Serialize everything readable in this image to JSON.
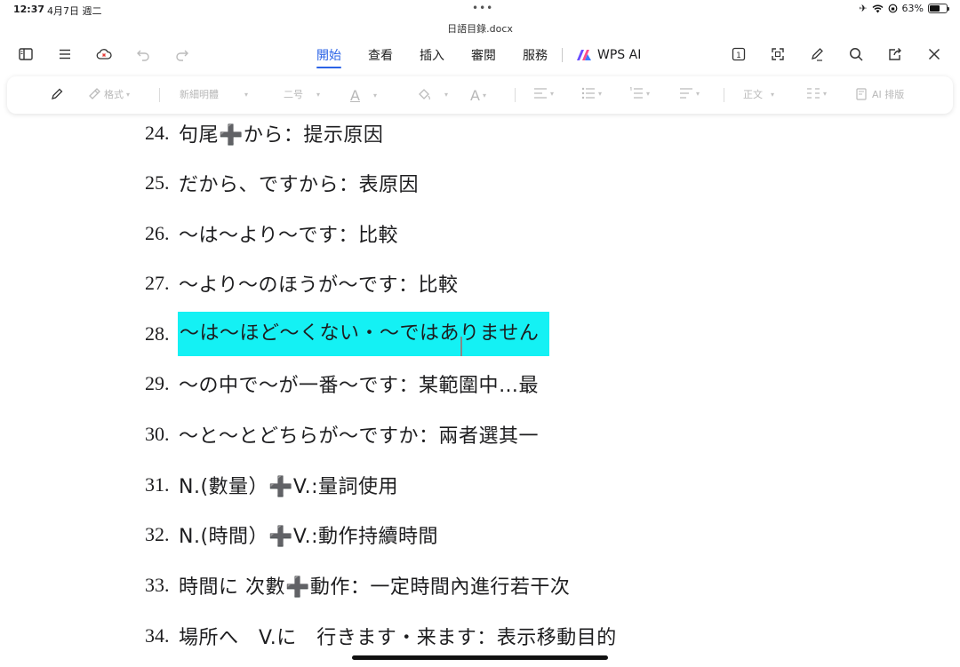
{
  "status_bar": {
    "time": "12:37",
    "date": "4月7日 週二",
    "battery": "63%",
    "battery_level": 0.63
  },
  "document": {
    "filename": "日語目錄.docx"
  },
  "menu": {
    "tabs": [
      "開始",
      "查看",
      "插入",
      "審閱",
      "服務"
    ],
    "active_tab": "開始",
    "ai_label": "WPS AI",
    "page_indicator": "1"
  },
  "format_toolbar": {
    "format_label": "格式",
    "font_name": "新細明體",
    "font_size": "二号",
    "style": "正文",
    "ai_layout": "AI 排版"
  },
  "lines": [
    {
      "num": "24.",
      "text": "句尾➕から：提示原因"
    },
    {
      "num": "25.",
      "text": "だから、ですから：表原因"
    },
    {
      "num": "26.",
      "text": "～は～より～です：比較"
    },
    {
      "num": "27.",
      "text": "～より～のほうが～です：比較"
    },
    {
      "num": "28.",
      "text": "～は～ほど～くない・～ではありません",
      "highlight": true
    },
    {
      "num": "29.",
      "text": "～の中で～が一番～です：某範圍中…最"
    },
    {
      "num": "30.",
      "text": "～と～とどちらが～ですか：兩者選其一"
    },
    {
      "num": "31.",
      "text": "N.(數量）➕V.:量詞使用"
    },
    {
      "num": "32.",
      "text": "N.(時間）➕V.:動作持續時間"
    },
    {
      "num": "33.",
      "text": "時間に 次數➕動作：一定時間內進行若干次"
    },
    {
      "num": "34.",
      "text": "場所へ　V.に　行きます・来ます：表示移動目的"
    }
  ],
  "colors": {
    "accent": "#2b63e6",
    "highlight": "#14f1f4"
  }
}
